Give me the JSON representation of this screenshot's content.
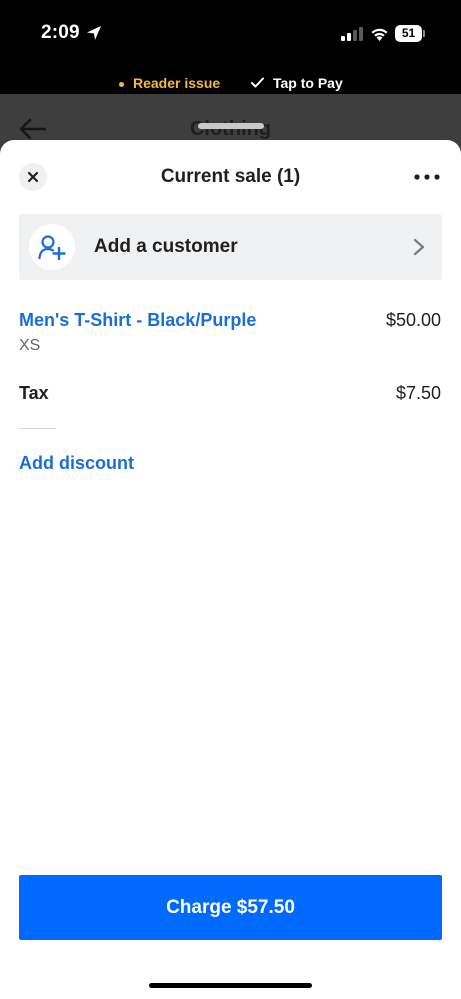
{
  "status_bar": {
    "time": "2:09",
    "battery": "51"
  },
  "banner": {
    "reader_issue": "Reader issue",
    "tap_to_pay": "Tap to Pay"
  },
  "background_page": {
    "title": "Clothing"
  },
  "sale": {
    "title": "Current sale (1)",
    "add_customer_label": "Add a customer",
    "items": [
      {
        "name": "Men's T-Shirt - Black/Purple",
        "variant": "XS",
        "price": "$50.00"
      }
    ],
    "tax_label": "Tax",
    "tax_value": "$7.50",
    "add_discount_label": "Add discount",
    "charge_label": "Charge $57.50"
  },
  "colors": {
    "accent_blue": "#006aff",
    "link_blue": "#1a6ed8",
    "reader_issue_yellow": "#f5b93b"
  },
  "icons": {
    "location": "location-arrow-icon",
    "signal": "cellular-signal-icon",
    "wifi": "wifi-icon",
    "battery": "battery-icon",
    "check": "check-icon",
    "back": "back-arrow-icon",
    "close": "close-icon",
    "more": "more-dots-icon",
    "add_customer": "add-person-icon",
    "chevron": "chevron-right-icon"
  }
}
